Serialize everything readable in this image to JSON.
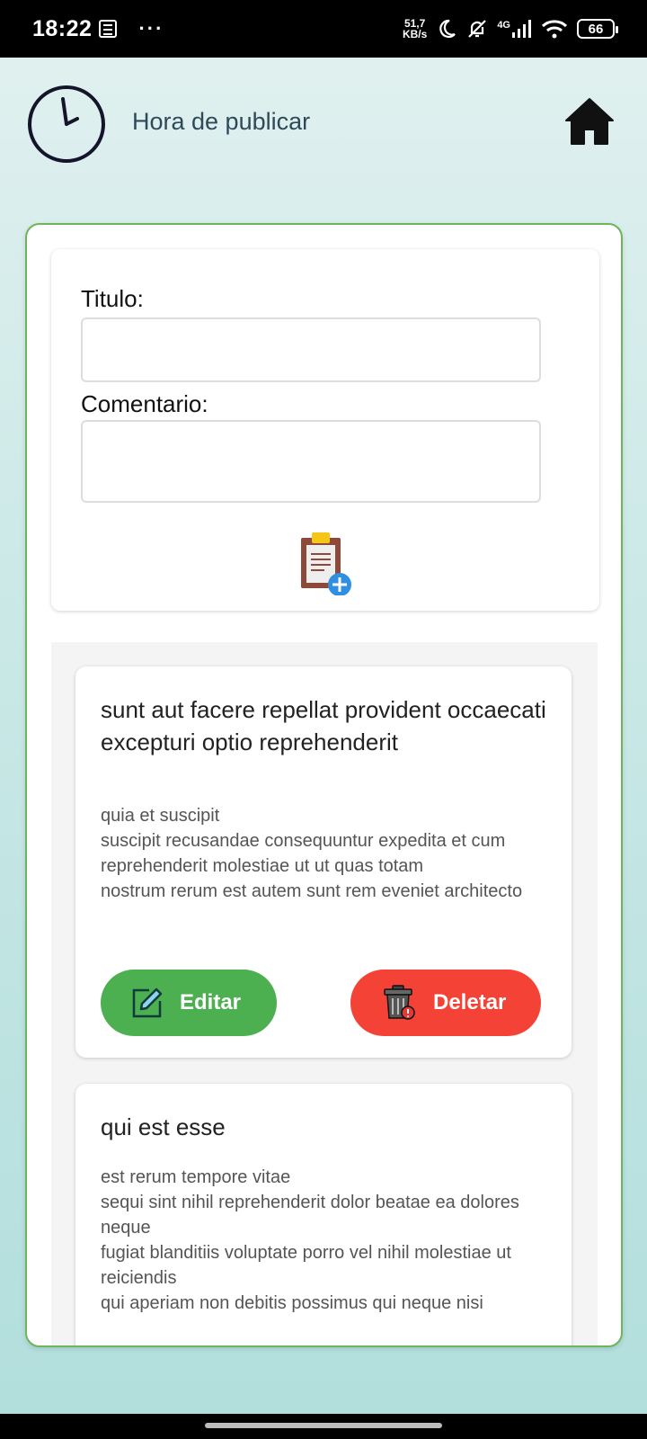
{
  "status_bar": {
    "time": "18:22",
    "dots": "···",
    "net_speed_value": "51,7",
    "net_speed_unit": "KB/s",
    "network": "4G",
    "battery": "66"
  },
  "header": {
    "title": "Hora de publicar"
  },
  "form": {
    "title_label": "Titulo:",
    "title_value": "",
    "comment_label": "Comentario:",
    "comment_value": ""
  },
  "posts": [
    {
      "title": "sunt aut facere repellat provident occaecati excepturi optio reprehenderit",
      "body_lines": [
        "quia et suscipit",
        "suscipit recusandae consequuntur expedita et cum",
        "reprehenderit molestiae ut ut quas totam",
        "nostrum rerum est autem sunt rem eveniet architecto"
      ],
      "edit_label": "Editar",
      "delete_label": "Deletar"
    },
    {
      "title": "qui est esse",
      "body_lines": [
        "est rerum tempore vitae",
        "sequi sint nihil reprehenderit dolor beatae ea dolores neque",
        "fugiat blanditiis voluptate porro vel nihil molestiae ut reiciendis",
        "qui aperiam non debitis possimus qui neque nisi"
      ]
    }
  ],
  "colors": {
    "edit_button": "#4caf50",
    "delete_button": "#f44336",
    "card_border": "#6db45a"
  },
  "icons": [
    "clock-icon",
    "home-icon",
    "clipboard-add-icon",
    "edit-icon",
    "trash-icon"
  ]
}
